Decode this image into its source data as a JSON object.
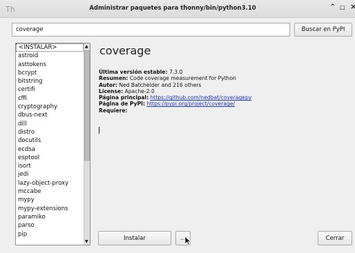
{
  "window": {
    "title": "Administrar paquetes para thonny/bin/python3.10",
    "controls": {
      "maximize": "^",
      "restore": "□",
      "close": "×"
    }
  },
  "search": {
    "value": "coverage",
    "button_label": "Buscar en PyPI"
  },
  "packages": [
    "<INSTALAR>",
    "astroid",
    "asttokens",
    "bcrypt",
    "bitstring",
    "certifi",
    "cffi",
    "cryptography",
    "dbus-next",
    "dill",
    "distro",
    "docutils",
    "ecdsa",
    "esptool",
    "isort",
    "jedi",
    "lazy-object-proxy",
    "mccabe",
    "mypy",
    "mypy-extensions",
    "paramiko",
    "parso",
    "pip"
  ],
  "details": {
    "name": "coverage",
    "latest_label": "Última versión estable:",
    "latest_value": "7.3.0",
    "summary_label": "Resumen:",
    "summary_value": "Code coverage measurement for Python",
    "author_label": "Autor:",
    "author_value": "Ned Batchelder and 216 others",
    "license_label": "License:",
    "license_value": "Apache-2.0",
    "homepage_label": "Página principal:",
    "homepage_value": "https://github.com/nedbat/coveragepy",
    "pypi_label": "Página de PyPI:",
    "pypi_value": "https://pypi.org/project/coverage/",
    "requires_label": "Requiere:"
  },
  "buttons": {
    "install": "Instalar",
    "more": "...",
    "close": "Cerrar"
  }
}
